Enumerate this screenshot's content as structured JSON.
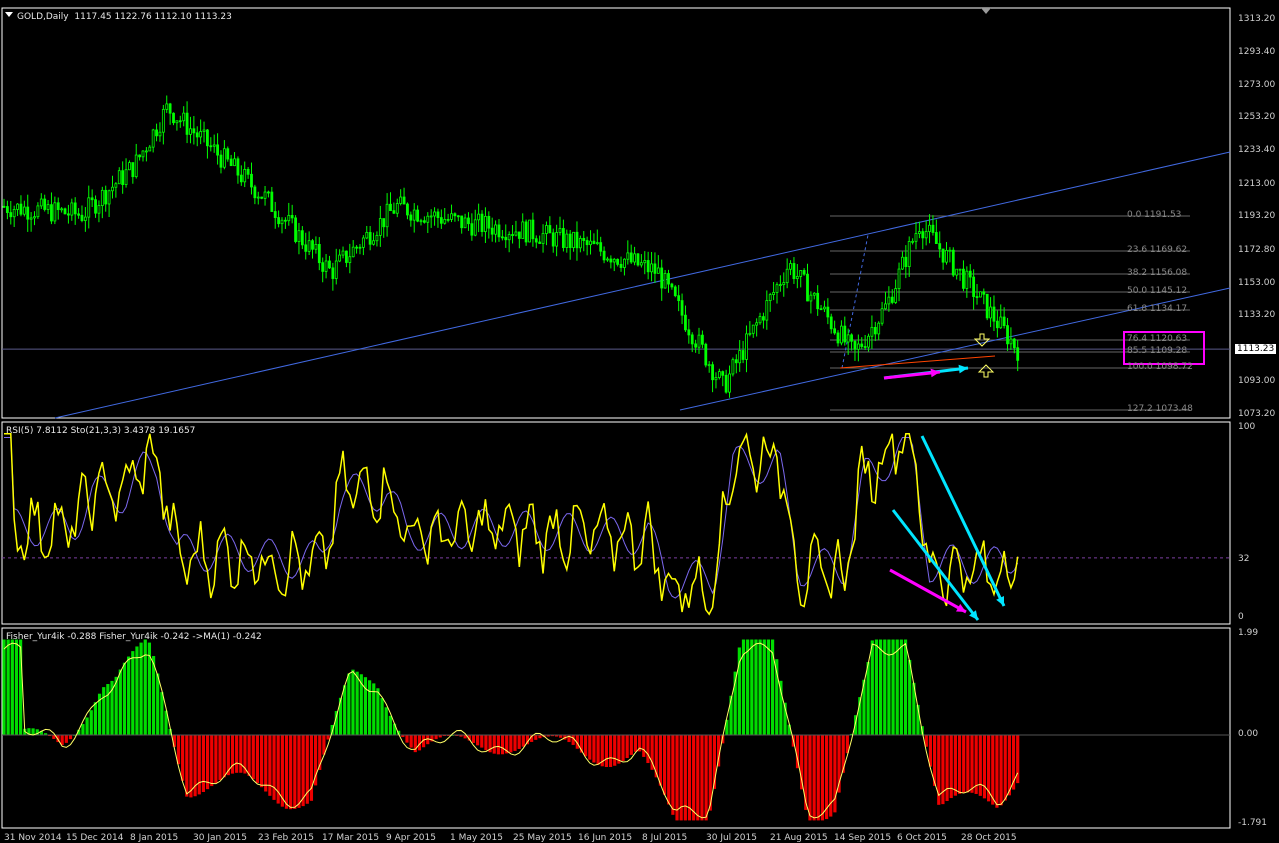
{
  "main_header": {
    "symbol": "GOLD,Daily",
    "ohlc": "1117.45 1122.76 1112.10 1113.23"
  },
  "rsi_header": "RSI(5) 7.8112  Sto(21,3,3) 3.4378 19.1657",
  "fisher_header": "Fisher_Yur4ik -0.288  Fisher_Yur4ik -0.242  ->MA(1) -0.242",
  "current_price": "1113.23",
  "price_axis": [
    "1313.20",
    "1293.40",
    "1273.00",
    "1253.20",
    "1233.40",
    "1213.00",
    "1193.20",
    "1172.80",
    "1153.00",
    "1133.20",
    "1113.23",
    "1093.00",
    "1073.20"
  ],
  "rsi_axis": [
    "100",
    "32",
    "0"
  ],
  "fisher_axis": [
    "1.99",
    "0.00",
    "-1.791"
  ],
  "fib_levels": [
    {
      "label": "0.0  1191.53"
    },
    {
      "label": "23.6  1169.62"
    },
    {
      "label": "38.2  1156.08"
    },
    {
      "label": "50.0  1145.12"
    },
    {
      "label": "61.8  1134.17"
    },
    {
      "label": "76.4  1120.63"
    },
    {
      "label": "85.5  1109.28"
    },
    {
      "label": "100.0  1098.72"
    },
    {
      "label": "127.2  1073.48"
    }
  ],
  "dates": [
    "31 Nov 2014",
    "15 Dec 2014",
    "8 Jan 2015",
    "30 Jan 2015",
    "23 Feb 2015",
    "17 Mar 2015",
    "9 Apr 2015",
    "1 May 2015",
    "25 May 2015",
    "16 Jun 2015",
    "8 Jul 2015",
    "30 Jul 2015",
    "21 Aug 2015",
    "14 Sep 2015",
    "6 Oct 2015",
    "28 Oct 2015"
  ],
  "colors": {
    "background": "#000000",
    "candle": "#00ff00",
    "channel": "#4169e1",
    "rsi_line": "#ffff00",
    "stoch_line": "#7b68ee",
    "fisher_pos": "#00dd00",
    "fisher_neg": "#ee0000",
    "fisher_signal": "#ffff66",
    "annot_cyan": "#00e5ff",
    "annot_magenta": "#ff00ff",
    "fib_line": "#666666"
  },
  "chart_data": [
    {
      "type": "candlestick",
      "title": "GOLD,Daily",
      "ylim": [
        1068,
        1318
      ],
      "x_range": [
        "31 Nov 2014",
        "28 Oct 2015"
      ],
      "x": [
        "31 Nov 2014",
        "15 Dec 2014",
        "8 Jan 2015",
        "30 Jan 2015",
        "23 Feb 2015",
        "17 Mar 2015",
        "9 Apr 2015",
        "1 May 2015",
        "25 May 2015",
        "16 Jun 2015",
        "8 Jul 2015",
        "30 Jul 2015",
        "21 Aug 2015",
        "14 Sep 2015",
        "6 Oct 2015",
        "28 Oct 2015"
      ],
      "close": [
        1200,
        1195,
        1225,
        1260,
        1205,
        1160,
        1200,
        1190,
        1185,
        1175,
        1160,
        1090,
        1165,
        1110,
        1140,
        1190,
        1150,
        1113.23
      ],
      "close_x_index": [
        0,
        1.2,
        2,
        2.5,
        4,
        5,
        6,
        7,
        8,
        9,
        10,
        11,
        12,
        13,
        13.5,
        14,
        14.8,
        15.5
      ]
    },
    {
      "type": "line",
      "title": "RSI(5) 7.8112  Sto(21,3,3) 3.4378 19.1657",
      "ylim": [
        0,
        100
      ],
      "levels": [
        32
      ]
    },
    {
      "type": "bar",
      "title": "Fisher_Yur4ik -0.288  Fisher_Yur4ik -0.242  ->MA(1) -0.242",
      "ylim": [
        -1.791,
        1.99
      ]
    }
  ]
}
